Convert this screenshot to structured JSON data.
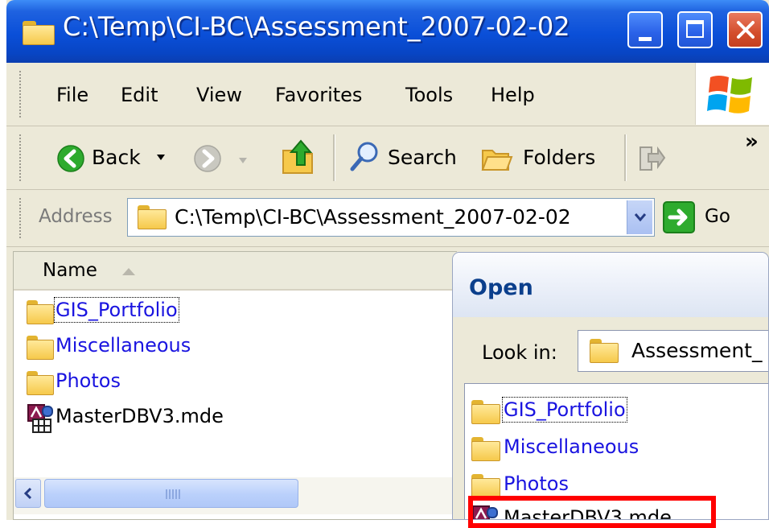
{
  "window": {
    "title": "C:\\Temp\\CI-BC\\Assessment_2007-02-02"
  },
  "menu": [
    "File",
    "Edit",
    "View",
    "Favorites",
    "Tools",
    "Help"
  ],
  "toolbar": {
    "back": "Back",
    "search": "Search",
    "folders": "Folders",
    "overflow": "»"
  },
  "address": {
    "label": "Address",
    "value": "C:\\Temp\\CI-BC\\Assessment_2007-02-02",
    "go": "Go"
  },
  "filepane": {
    "column": "Name",
    "items": [
      {
        "name": "GIS_Portfolio",
        "type": "folder"
      },
      {
        "name": "Miscellaneous",
        "type": "folder"
      },
      {
        "name": "Photos",
        "type": "folder"
      },
      {
        "name": "MasterDBV3.mde",
        "type": "access-file"
      }
    ]
  },
  "open_dialog": {
    "title": "Open",
    "look_in_label": "Look in:",
    "look_in_value": "Assessment_",
    "items": [
      {
        "name": "GIS_Portfolio",
        "type": "folder"
      },
      {
        "name": "Miscellaneous",
        "type": "folder"
      },
      {
        "name": "Photos",
        "type": "folder"
      },
      {
        "name": "MasterDBV3.mde",
        "type": "access-file"
      }
    ]
  },
  "colors": {
    "titlebar": "#0a4fd8",
    "folder_link": "#1a14e0",
    "highlight": "#ff0000",
    "go_green": "#2eab2e"
  },
  "icons": [
    "folder-icon",
    "windows-logo-icon",
    "back-arrow-icon",
    "forward-arrow-icon",
    "up-folder-icon",
    "search-icon",
    "folders-icon",
    "move-to-icon",
    "go-arrow-icon",
    "access-db-icon"
  ]
}
